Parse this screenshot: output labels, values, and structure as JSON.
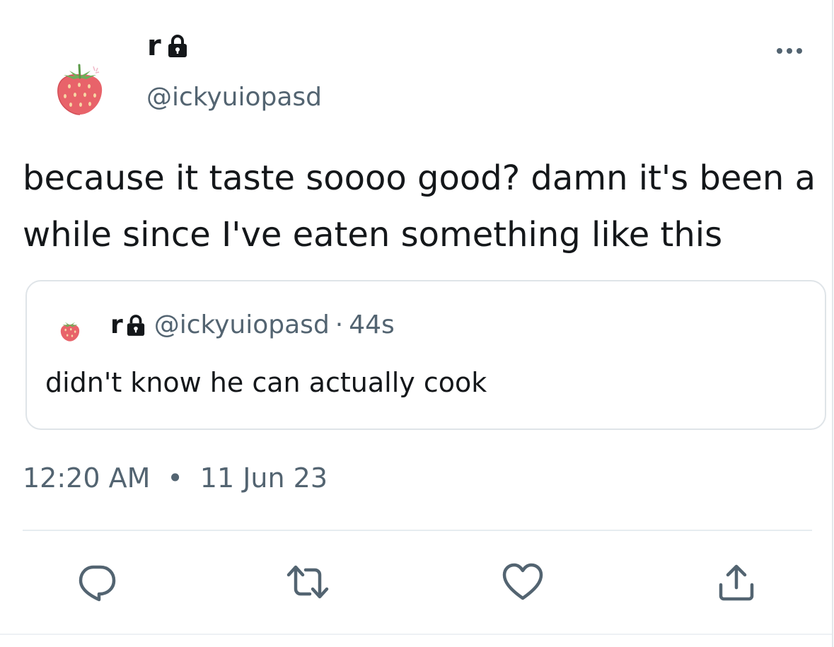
{
  "tweet": {
    "author": {
      "display_name": "r",
      "handle": "@ickyuiopasd",
      "avatar_icon": "strawberry-icon",
      "protected_icon": "lock-icon"
    },
    "text": "because it taste soooo good? damn it's been a while since I've eaten something like this",
    "more_icon": "more-dots-icon",
    "quoted": {
      "display_name": "r",
      "handle": "@ickyuiopasd",
      "separator": "·",
      "age": "44s",
      "text": "didn't know he can actually cook"
    },
    "timestamp": {
      "time": "12:20 AM",
      "dot": "•",
      "date": "11 Jun 23"
    },
    "actions": [
      {
        "name": "reply",
        "icon": "reply-icon"
      },
      {
        "name": "retweet",
        "icon": "retweet-icon"
      },
      {
        "name": "like",
        "icon": "heart-icon"
      },
      {
        "name": "share",
        "icon": "share-icon"
      }
    ],
    "colors": {
      "text": "#14171a",
      "secondary": "#536471",
      "border": "#dfe4e8",
      "strawberry": "#e8636a",
      "leaf": "#6fae5a"
    }
  }
}
